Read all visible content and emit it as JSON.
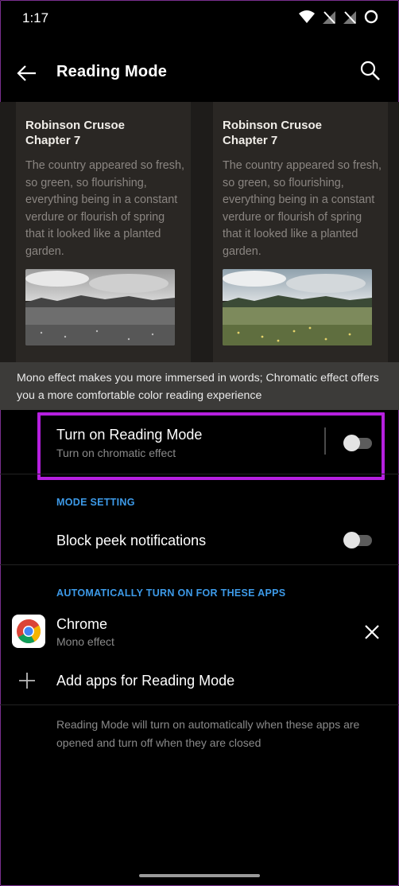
{
  "status_bar": {
    "time": "1:17"
  },
  "app_bar": {
    "title": "Reading Mode"
  },
  "preview": {
    "cards": [
      {
        "title_line1": "Robinson Crusoe",
        "title_line2": "Chapter 7",
        "body": "The country appeared so fresh, so green, so flourishing, everything being in a constant verdure or flourish of spring that it looked like a planted garden.",
        "image_style": "mono"
      },
      {
        "title_line1": "Robinson Crusoe",
        "title_line2": "Chapter 7",
        "body": "The country appeared so fresh, so green, so flourishing, everything being in a constant verdure or flourish of spring that it looked like a planted garden.",
        "image_style": "chromatic"
      }
    ],
    "banner": "Mono effect makes you more immersed in words; Chromatic effect offers you a more comfortable color reading experience"
  },
  "reading_mode": {
    "title": "Turn on Reading Mode",
    "subtitle": "Turn on chromatic effect",
    "enabled": false
  },
  "mode_setting": {
    "header": "MODE SETTING",
    "block_peek": {
      "title": "Block peek notifications",
      "enabled": false
    }
  },
  "auto_apps": {
    "header": "AUTOMATICALLY TURN ON FOR THESE APPS",
    "apps": [
      {
        "name": "Chrome",
        "effect": "Mono effect",
        "icon": "chrome-icon"
      }
    ],
    "add_label": "Add apps for Reading Mode",
    "footer": "Reading Mode will turn on automatically when these apps are opened and turn off when they are closed"
  },
  "colors": {
    "accent": "#3d9ae8",
    "highlight": "#b620e0",
    "banner_bg": "#3c3b39"
  }
}
